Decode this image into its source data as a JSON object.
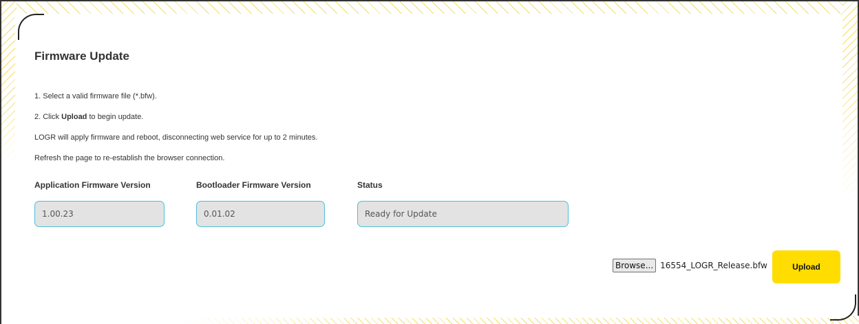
{
  "page": {
    "title": "Firmware Update"
  },
  "instructions": {
    "step1": "1. Select a valid firmware file (*.bfw).",
    "step2_prefix": "2. Click ",
    "step2_bold": "Upload",
    "step2_suffix": " to begin update.",
    "note1": "LOGR will apply firmware and reboot, disconnecting web service for up to 2 minutes.",
    "note2": "Refresh the page to re-establish the browser connection."
  },
  "fields": {
    "app_label": "Application Firmware Version",
    "app_value": "1.00.23",
    "boot_label": "Bootloader Firmware Version",
    "boot_value": "0.01.02",
    "status_label": "Status",
    "status_value": "Ready for Update"
  },
  "file": {
    "browse_label": "Browse...",
    "selected_file": "16554_LOGR_Release.bfw"
  },
  "actions": {
    "upload_label": "Upload"
  },
  "colors": {
    "accent_yellow": "#ffdd00",
    "field_border": "#4dbfd8",
    "hatch": "#f4dd6a"
  }
}
